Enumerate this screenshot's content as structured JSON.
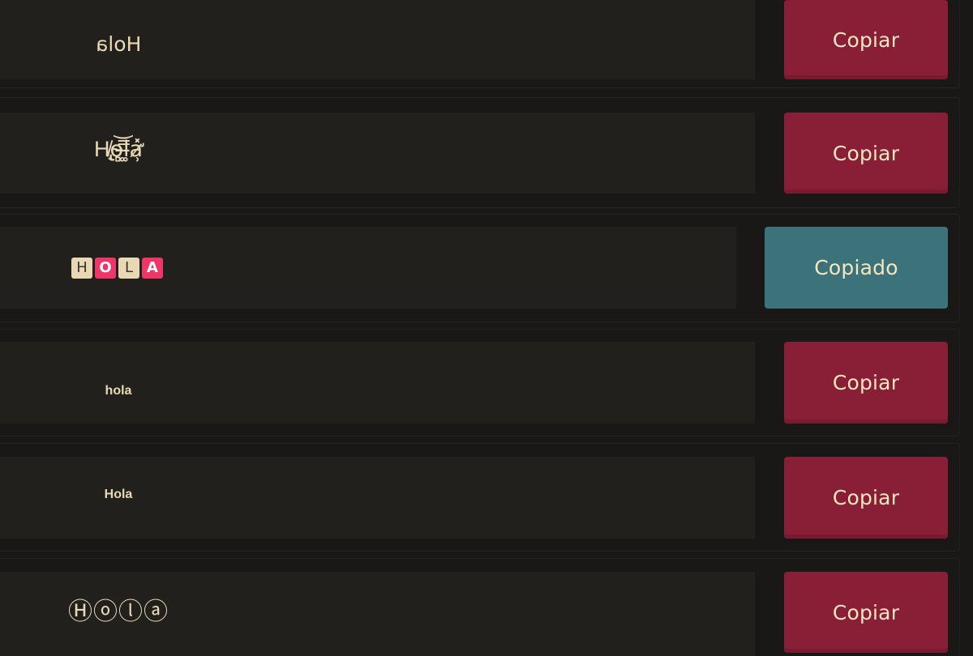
{
  "rows": [
    {
      "preview": "Hola",
      "style": "mirrored",
      "button": "Copiar",
      "state": "default"
    },
    {
      "preview": "H̸̢͔o̴̻͝l̶͚̿a̷̛̹̽",
      "style": "zalgo",
      "button": "Copiar",
      "state": "default"
    },
    {
      "preview": [
        "H",
        "O",
        "L",
        "A"
      ],
      "style": "tiles",
      "button": "Copiado",
      "state": "copied"
    },
    {
      "preview": "hola",
      "style": "small-bold",
      "button": "Copiar",
      "state": "default"
    },
    {
      "preview": "Hola",
      "style": "small-bold",
      "button": "Copiar",
      "state": "default"
    },
    {
      "preview": "Ⓗⓞⓛⓐ",
      "style": "circled",
      "button": "Copiar",
      "state": "default"
    }
  ],
  "colors": {
    "page_bg": "#191816",
    "panel_bg": "#22201d",
    "preview_text": "#e9d9b5",
    "button_red": "#891e37",
    "button_teal": "#3c727a",
    "button_text": "#f6e6bd",
    "tile_beige": "#e9d8b4",
    "tile_pink": "#ee3768"
  }
}
